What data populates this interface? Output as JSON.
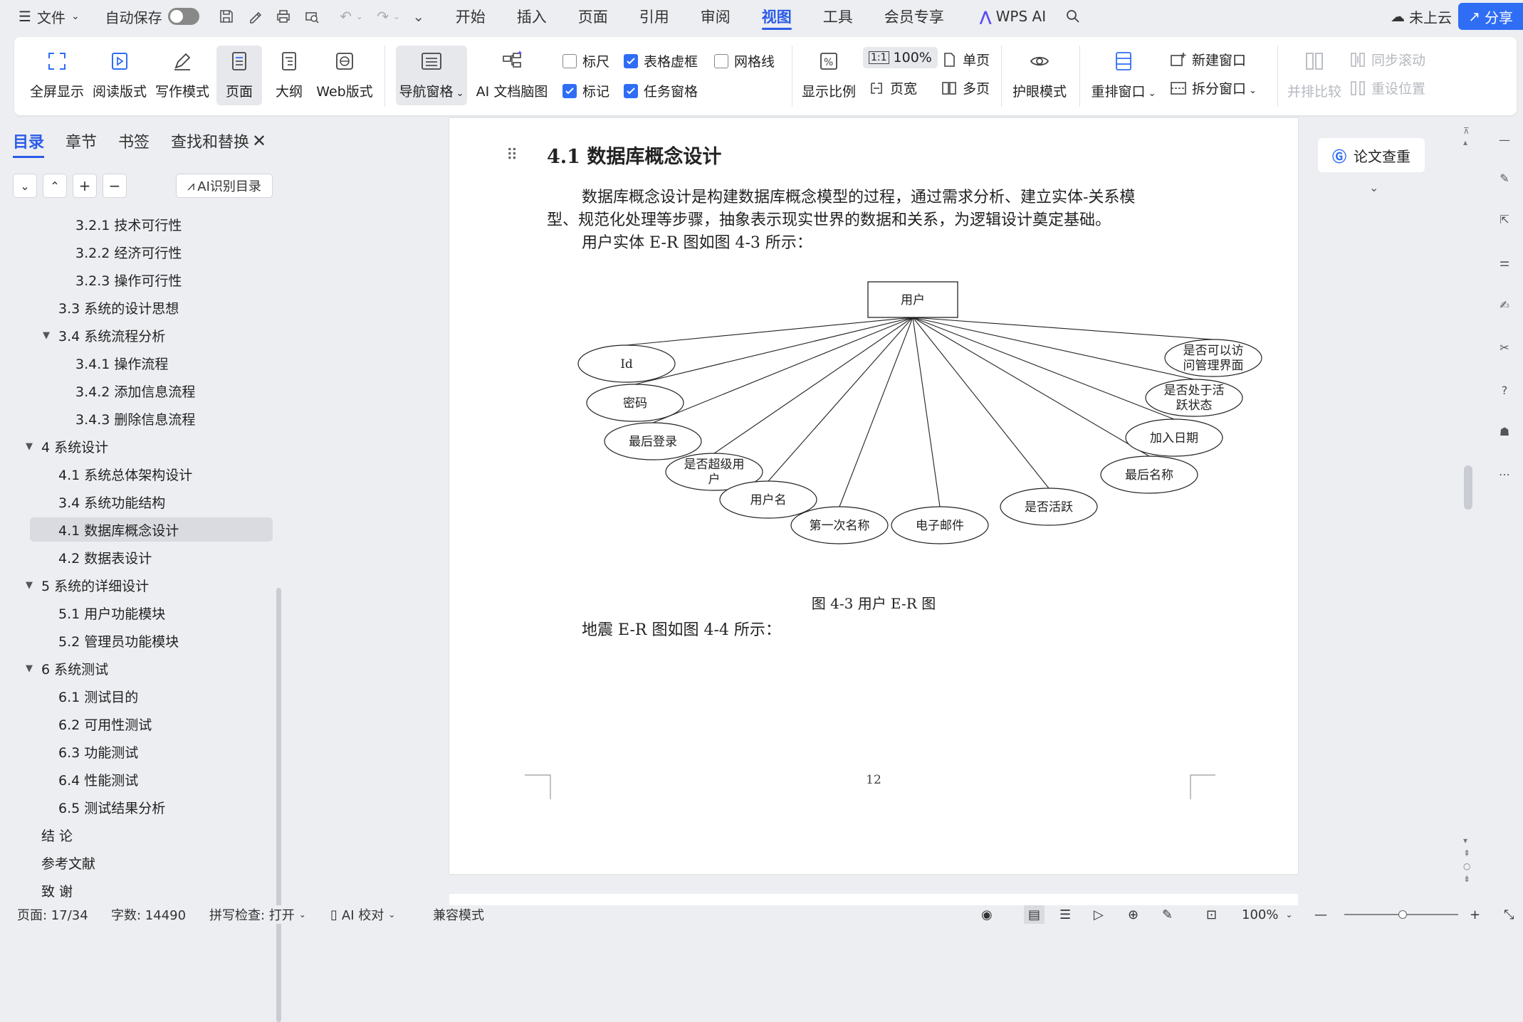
{
  "titlebar": {
    "menu": "文件",
    "autosave": "自动保存",
    "tabs": [
      "开始",
      "插入",
      "页面",
      "引用",
      "审阅",
      "视图",
      "工具",
      "会员专享"
    ],
    "active_tab": "视图",
    "wps_ai": "WPS AI",
    "cloud": "未上云",
    "share": "分享"
  },
  "ribbon": {
    "fullscreen": "全屏显示",
    "reading": "阅读版式",
    "writing": "写作模式",
    "page": "页面",
    "outline": "大纲",
    "web": "Web版式",
    "nav_pane": "导航窗格",
    "ai_mindmap": "AI 文档脑图",
    "ruler": "标尺",
    "table_gridlines": "表格虚框",
    "gridlines": "网格线",
    "marks": "标记",
    "task_pane": "任务窗格",
    "zoom_ratio": "显示比例",
    "zoom_value": "100%",
    "page_width": "页宽",
    "single_page": "单页",
    "multi_page": "多页",
    "eye_care": "护眼模式",
    "arrange": "重排窗口",
    "new_window": "新建窗口",
    "split_window": "拆分窗口",
    "side_by_side": "并排比较",
    "sync_scroll": "同步滚动",
    "reset_position": "重设位置"
  },
  "sidebar": {
    "tabs": [
      "目录",
      "章节",
      "书签",
      "查找和替换"
    ],
    "ai_toc": "AI识别目录",
    "items": [
      {
        "label": "3.2.1 技术可行性",
        "level": 3
      },
      {
        "label": "3.2.2 经济可行性",
        "level": 3
      },
      {
        "label": "3.2.3 操作可行性",
        "level": 3
      },
      {
        "label": "3.3 系统的设计思想",
        "level": 2
      },
      {
        "label": "3.4 系统流程分析",
        "level": 2,
        "expanded": true
      },
      {
        "label": "3.4.1 操作流程",
        "level": 3
      },
      {
        "label": "3.4.2 添加信息流程",
        "level": 3
      },
      {
        "label": "3.4.3 删除信息流程",
        "level": 3
      },
      {
        "label": "4 系统设计",
        "level": 1,
        "expanded": true
      },
      {
        "label": "4.1  系统总体架构设计",
        "level": 2
      },
      {
        "label": "3.4 系统功能结构",
        "level": 2
      },
      {
        "label": "4.1 数据库概念设计",
        "level": 2,
        "selected": true
      },
      {
        "label": "4.2 数据表设计",
        "level": 2
      },
      {
        "label": "5 系统的详细设计",
        "level": 1,
        "expanded": true
      },
      {
        "label": "5.1 用户功能模块",
        "level": 2
      },
      {
        "label": "5.2 管理员功能模块",
        "level": 2
      },
      {
        "label": "6 系统测试",
        "level": 1,
        "expanded": true
      },
      {
        "label": "6.1 测试目的",
        "level": 2
      },
      {
        "label": "6.2 可用性测试",
        "level": 2
      },
      {
        "label": "6.3 功能测试",
        "level": 2
      },
      {
        "label": "6.4 性能测试",
        "level": 2
      },
      {
        "label": "6.5 测试结果分析",
        "level": 2
      },
      {
        "label": "结    论",
        "level": 1
      },
      {
        "label": "参考文献",
        "level": 1
      },
      {
        "label": "致    谢",
        "level": 1
      }
    ]
  },
  "document": {
    "heading": "4.1 数据库概念设计",
    "para1_line1": "数据库概念设计是构建数据库概念模型的过程，通过需求分析、建立实体-关系模",
    "para1_line2": "型、规范化处理等步骤，抽象表示现实世界的数据和关系，为逻辑设计奠定基础。",
    "para2": "用户实体 E-R 图如图 4-3 所示：",
    "er": {
      "entity": "用户",
      "attributes": [
        "Id",
        "密码",
        "最后登录",
        "是否超级用户",
        "用户名",
        "第一次名称",
        "电子邮件",
        "是否活跃",
        "最后名称",
        "加入日期",
        "是否处于活跃状态",
        "是否可以访问管理界面"
      ]
    },
    "caption": "图 4-3 用户 E-R 图",
    "para3": "地震 E-R 图如图 4-4 所示：",
    "page_number": "12"
  },
  "right_panel": {
    "paper_check": "论文查重"
  },
  "status": {
    "page": "页面: 17/34",
    "words": "字数: 14490",
    "spell": "拼写检查: 打开",
    "ai_proof": "AI 校对",
    "compat": "兼容模式",
    "zoom": "100%"
  }
}
